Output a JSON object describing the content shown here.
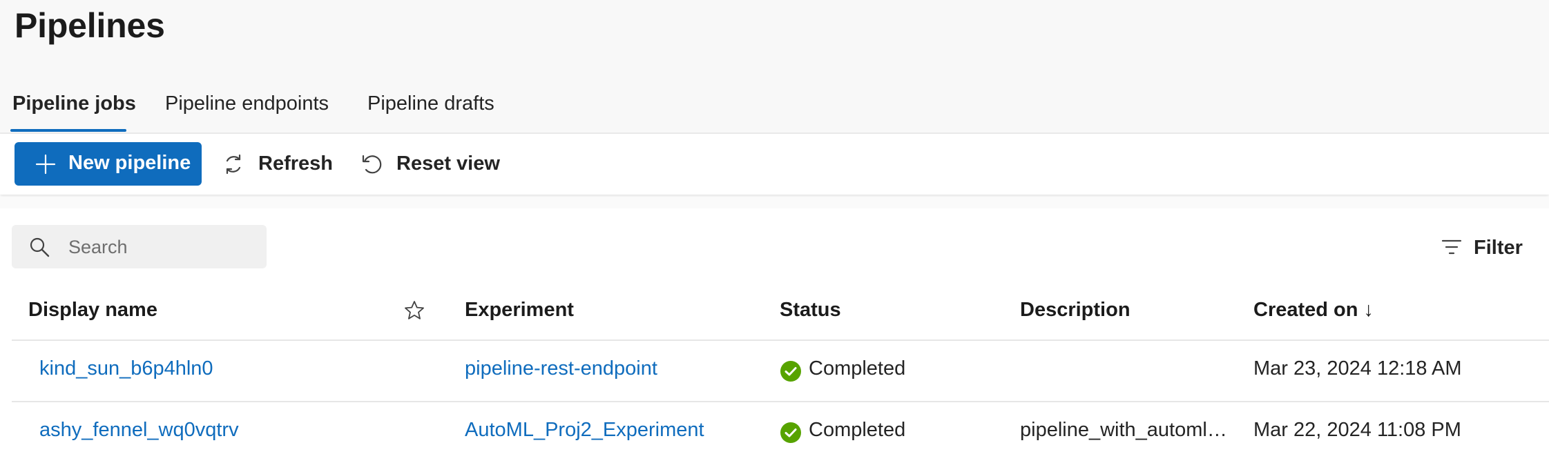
{
  "page": {
    "title": "Pipelines"
  },
  "tabs": [
    {
      "label": "Pipeline jobs",
      "active": true
    },
    {
      "label": "Pipeline endpoints",
      "active": false
    },
    {
      "label": "Pipeline drafts",
      "active": false
    }
  ],
  "toolbar": {
    "new_pipeline_label": "New pipeline",
    "refresh_label": "Refresh",
    "reset_view_label": "Reset view"
  },
  "search": {
    "placeholder": "Search"
  },
  "filter": {
    "label": "Filter"
  },
  "table": {
    "columns": {
      "display_name": "Display name",
      "experiment": "Experiment",
      "status": "Status",
      "description": "Description",
      "created_on": "Created on ↓"
    },
    "rows": [
      {
        "display_name": "kind_sun_b6p4hln0",
        "experiment": "pipeline-rest-endpoint",
        "status": "Completed",
        "description": "",
        "created_on": "Mar 23, 2024 12:18 AM"
      },
      {
        "display_name": "ashy_fennel_wq0vqtrv",
        "experiment": "AutoML_Proj2_Experiment",
        "status": "Completed",
        "description": "pipeline_with_automls...",
        "created_on": "Mar 22, 2024 11:08 PM"
      }
    ]
  },
  "colors": {
    "accent": "#0f6cbd",
    "success": "#57a300",
    "header_bg": "#f8f8f8"
  },
  "icons": {
    "new_pipeline": "plus-icon",
    "refresh": "refresh-icon",
    "reset_view": "undo-icon",
    "search": "search-icon",
    "filter": "filter-icon",
    "favorite": "star-outline-icon",
    "status_completed": "checkmark-circle-icon"
  }
}
